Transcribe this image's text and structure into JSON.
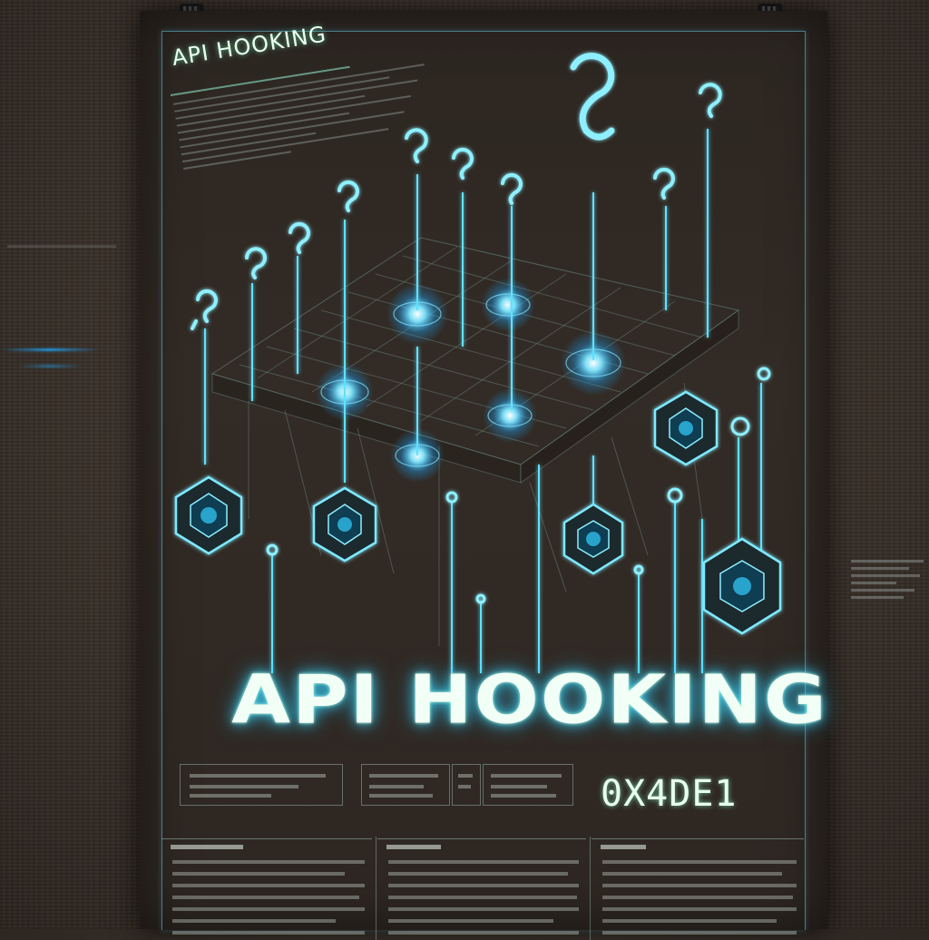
{
  "poster": {
    "header_title": "API HOOKING",
    "main_title": "API HOOKING",
    "code": "0X4DE1"
  },
  "colors": {
    "glow_cyan": "#3ad0ff",
    "glow_green": "#7dffb0",
    "poster_bg": "#2e2722",
    "wall_bg": "#3a312a"
  },
  "icons": [
    "hook-icon",
    "chip-icon",
    "circuit-node-icon",
    "pushpin-icon"
  ]
}
